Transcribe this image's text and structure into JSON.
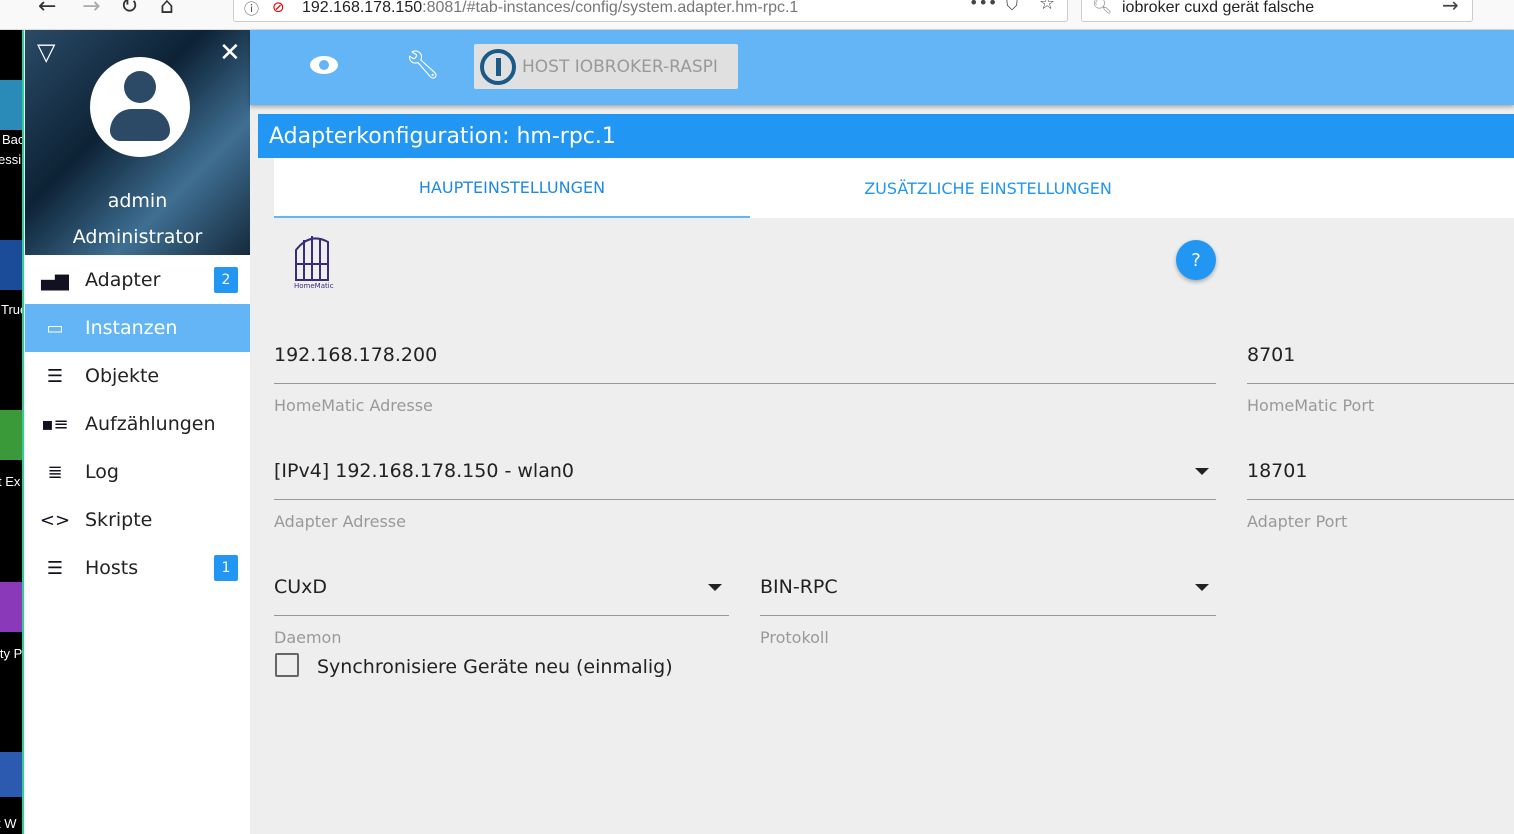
{
  "browser": {
    "url_host": "192.168.178.150",
    "url_rest": ":8081/#tab-instances/config/system.adapter.hm-rpc.1",
    "search": "iobroker cuxd gerät falsche"
  },
  "desktop": {
    "fragments": [
      "Bac",
      "essi",
      "True",
      "t Ex",
      "ity P",
      "t W"
    ]
  },
  "drawer": {
    "username": "admin",
    "role": "Administrator",
    "items": [
      {
        "label": "Adapter",
        "badge": "2"
      },
      {
        "label": "Instanzen"
      },
      {
        "label": "Objekte"
      },
      {
        "label": "Aufzählungen"
      },
      {
        "label": "Log"
      },
      {
        "label": "Skripte"
      },
      {
        "label": "Hosts",
        "badge": "1"
      }
    ]
  },
  "topbar": {
    "host": "HOST IOBROKER-RASPI"
  },
  "title": "Adapterkonfiguration: hm-rpc.1",
  "tabs": [
    "HAUPTEINSTELLUNGEN",
    "ZUSÄTZLICHE EINSTELLUNGEN"
  ],
  "logo_text": "HomeMatic",
  "fields": {
    "hm_address": {
      "value": "192.168.178.200",
      "label": "HomeMatic Adresse"
    },
    "hm_port": {
      "value": "8701",
      "label": "HomeMatic Port"
    },
    "adapter_address": {
      "value": "[IPv4] 192.168.178.150 - wlan0",
      "label": "Adapter Adresse"
    },
    "adapter_port": {
      "value": "18701",
      "label": "Adapter Port"
    },
    "daemon": {
      "value": "CUxD",
      "label": "Daemon"
    },
    "protocol": {
      "value": "BIN-RPC",
      "label": "Protokoll"
    },
    "sync": {
      "label": "Synchronisiere Geräte neu (einmalig)",
      "checked": false
    }
  },
  "colors": {
    "primary": "#2196f3",
    "light": "#64b5f6"
  }
}
